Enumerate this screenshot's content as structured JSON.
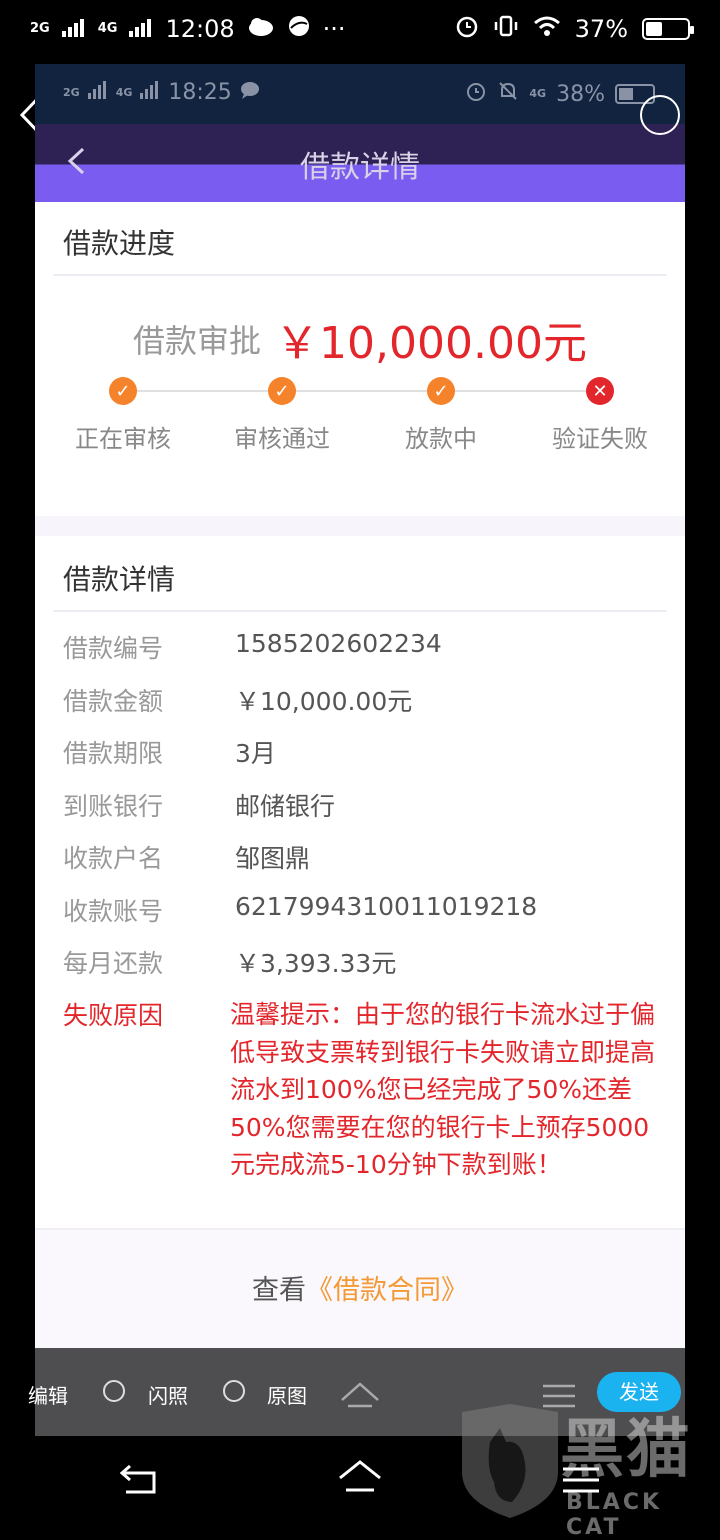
{
  "outer_status": {
    "signal1": "2G",
    "signal2": "4G",
    "time": "12:08",
    "battery": "37%",
    "battery_level": 0.37,
    "more": "···"
  },
  "inner_status": {
    "signal1": "2G",
    "signal2": "4G",
    "time": "18:25",
    "network": "4G",
    "battery": "38%",
    "battery_level": 0.38
  },
  "header": {
    "title": "借款详情"
  },
  "progress": {
    "title": "借款进度",
    "approval_label": "借款审批",
    "amount": "￥10,000.00元",
    "steps": [
      {
        "label": "正在审核",
        "status": "done",
        "glyph": "✓",
        "color": "#f5832b"
      },
      {
        "label": "审核通过",
        "status": "done",
        "glyph": "✓",
        "color": "#f5832b"
      },
      {
        "label": "放款中",
        "status": "done",
        "glyph": "✓",
        "color": "#f5832b"
      },
      {
        "label": "验证失败",
        "status": "failed",
        "glyph": "✕",
        "color": "#e3262b"
      }
    ]
  },
  "details": {
    "title": "借款详情",
    "rows": [
      {
        "key": "借款编号",
        "value": "1585202602234"
      },
      {
        "key": "借款金额",
        "value": "￥10,000.00元"
      },
      {
        "key": "借款期限",
        "value": "3月"
      },
      {
        "key": "到账银行",
        "value": "邮储银行"
      },
      {
        "key": "收款户名",
        "value": "邹图鼎"
      },
      {
        "key": "收款账号",
        "value": "6217994310011019218"
      },
      {
        "key": "每月还款",
        "value": "￥3,393.33元"
      }
    ],
    "reason_key": "失败原因",
    "reason_value": "温馨提示：由于您的银行卡流水过于偏低导致支票转到银行卡失败请立即提高流水到100%您已经完成了50%还差50%您需要在您的银行卡上预存5000元完成流5-10分钟下款到账！"
  },
  "contract": {
    "prefix": "查看",
    "link": "《借款合同》"
  },
  "bottom_toolbar": {
    "edit": "编辑",
    "flash": "闪照",
    "original": "原图",
    "send": "发送"
  },
  "watermark": {
    "big": "黑猫",
    "small": "BLACK CAT"
  }
}
